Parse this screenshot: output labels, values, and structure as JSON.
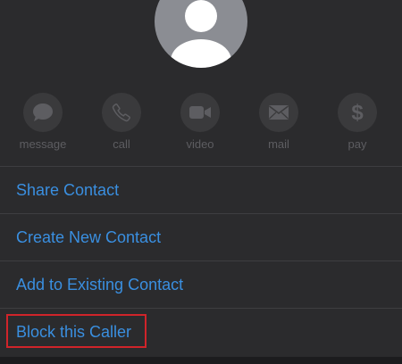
{
  "contact": {
    "avatar_icon": "person-silhouette-icon"
  },
  "actions": [
    {
      "id": "message",
      "label": "message",
      "icon": "message-bubble-icon"
    },
    {
      "id": "call",
      "label": "call",
      "icon": "phone-icon"
    },
    {
      "id": "video",
      "label": "video",
      "icon": "video-camera-icon"
    },
    {
      "id": "mail",
      "label": "mail",
      "icon": "envelope-icon"
    },
    {
      "id": "pay",
      "label": "pay",
      "icon": "dollar-icon"
    }
  ],
  "menu": {
    "items": [
      {
        "label": "Share Contact"
      },
      {
        "label": "Create New Contact"
      },
      {
        "label": "Add to Existing Contact"
      },
      {
        "label": "Block this Caller"
      }
    ]
  },
  "colors": {
    "background": "#2b2b2d",
    "link": "#3a8fe0",
    "action_icon": "#5d5d61",
    "highlight": "#d0242a"
  }
}
